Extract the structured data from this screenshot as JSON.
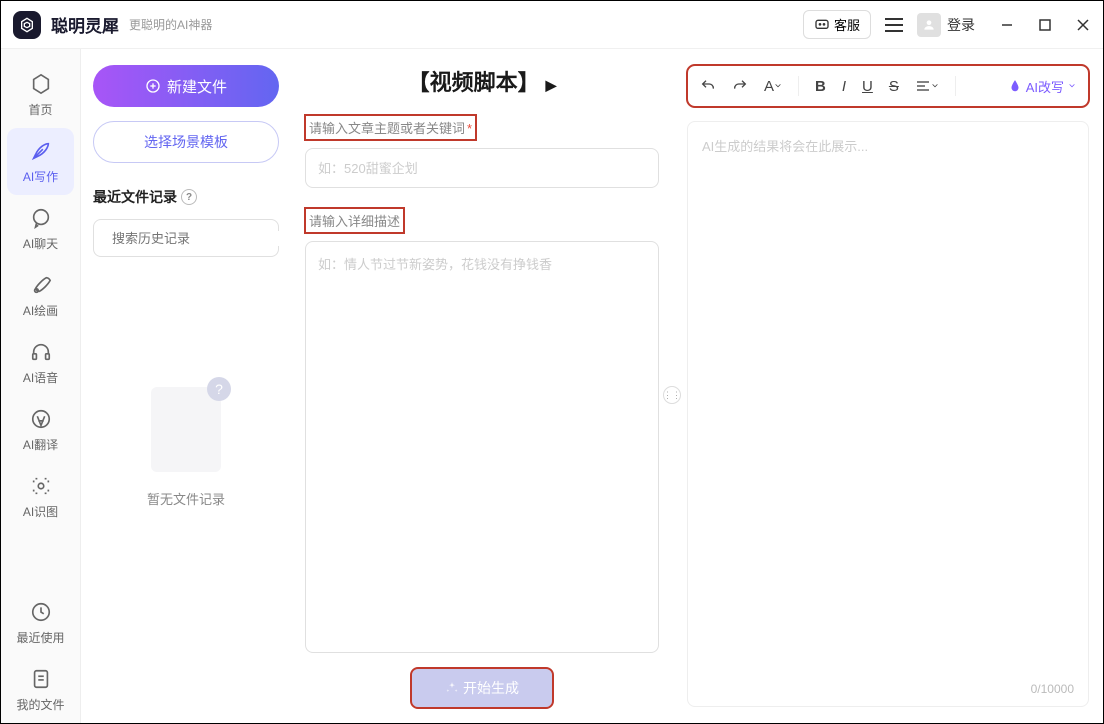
{
  "app": {
    "name": "聪明灵犀",
    "tagline": "更聪明的AI神器"
  },
  "titlebar": {
    "kefu": "客服",
    "login": "登录"
  },
  "sidebar": {
    "items": [
      {
        "label": "首页"
      },
      {
        "label": "AI写作"
      },
      {
        "label": "AI聊天"
      },
      {
        "label": "AI绘画"
      },
      {
        "label": "AI语音"
      },
      {
        "label": "AI翻译"
      },
      {
        "label": "AI识图"
      },
      {
        "label": "最近使用"
      },
      {
        "label": "我的文件"
      }
    ]
  },
  "filepanel": {
    "new_file": "新建文件",
    "choose_template": "选择场景模板",
    "recent_label": "最近文件记录",
    "search_placeholder": "搜索历史记录",
    "empty_text": "暂无文件记录"
  },
  "editor": {
    "title": "【视频脚本】",
    "label_topic": "请输入文章主题或者关键词",
    "label_required": "*",
    "topic_placeholder": "如：520甜蜜企划",
    "label_detail": "请输入详细描述",
    "detail_placeholder": "如：情人节过节新姿势，花钱没有挣钱香",
    "generate": "开始生成"
  },
  "output": {
    "rewrite_label": "AI改写",
    "placeholder": "AI生成的结果将会在此展示...",
    "char_count": "0/10000"
  }
}
